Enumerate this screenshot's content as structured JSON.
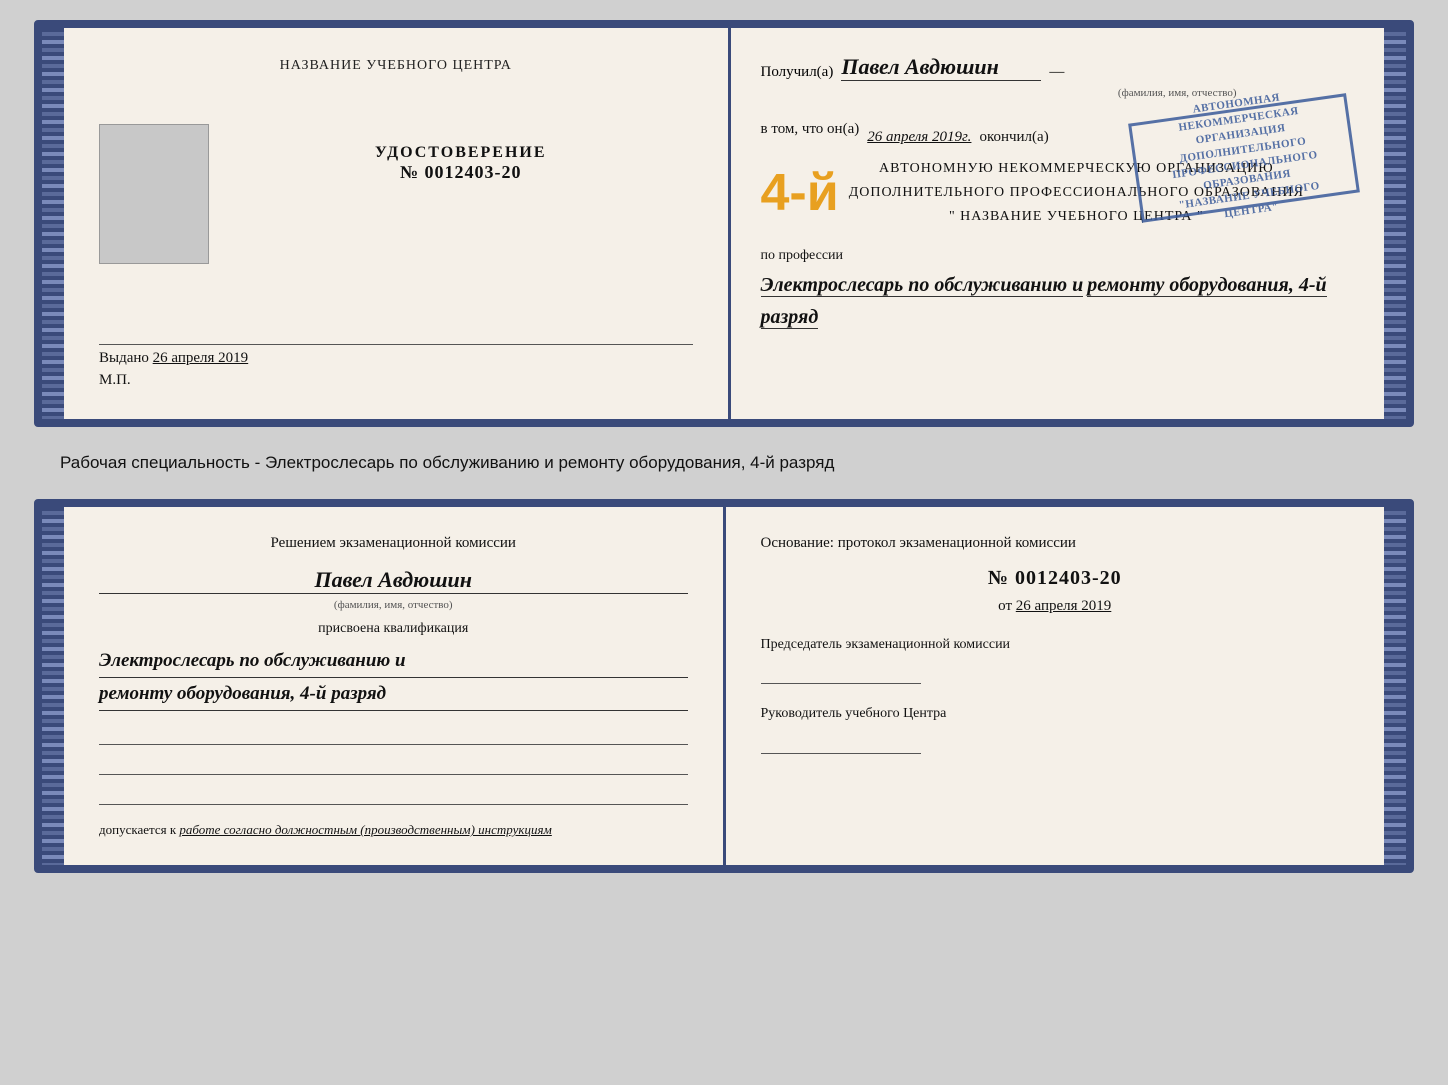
{
  "top_doc": {
    "left": {
      "title": "НАЗВАНИЕ УЧЕБНОГО ЦЕНТРА",
      "cert_label": "УДОСТОВЕРЕНИЕ",
      "cert_number": "№ 0012403-20",
      "issued_text": "Выдано",
      "issued_date": "26 апреля 2019",
      "mp_label": "М.П."
    },
    "right": {
      "received_prefix": "Получил(а)",
      "person_name": "Павел Авдюшин",
      "fio_label": "(фамилия, имя, отчество)",
      "in_that_prefix": "в том, что он(а)",
      "date_italic": "26 апреля 2019г.",
      "finished": "окончил(а)",
      "big_grade": "4-й",
      "org_line1": "АВТОНОМНУЮ НЕКОММЕРЧЕСКУЮ ОРГАНИЗАЦИЮ",
      "org_line2": "ДОПОЛНИТЕЛЬНОГО ПРОФЕССИОНАЛЬНОГО ОБРАЗОВАНИЯ",
      "org_line3": "\" НАЗВАНИЕ УЧЕБНОГО ЦЕНТРА \"",
      "profession_label": "по профессии",
      "profession_value": "Электрослесарь по обслуживанию и",
      "profession_value2": "ремонту оборудования, 4-й разряд"
    }
  },
  "middle": {
    "text": "Рабочая специальность - Электрослесарь по обслуживанию и ремонту оборудования, 4-й разряд"
  },
  "bottom_doc": {
    "left": {
      "section_title": "Решением экзаменационной комиссии",
      "person_name": "Павел Авдюшин",
      "fio_label": "(фамилия, имя, отчество)",
      "assigned_label": "присвоена квалификация",
      "qualification_line1": "Электрослесарь по обслуживанию и",
      "qualification_line2": "ремонту оборудования, 4-й разряд",
      "допускается_prefix": "допускается к",
      "допускается_value": "работе согласно должностным (производственным) инструкциям"
    },
    "right": {
      "osnov_label": "Основание: протокол экзаменационной  комиссии",
      "protocol_number": "№  0012403-20",
      "ot_text": "от",
      "ot_date": "26 апреля 2019",
      "chairman_label": "Председатель экзаменационной комиссии",
      "director_label": "Руководитель учебного Центра"
    }
  }
}
